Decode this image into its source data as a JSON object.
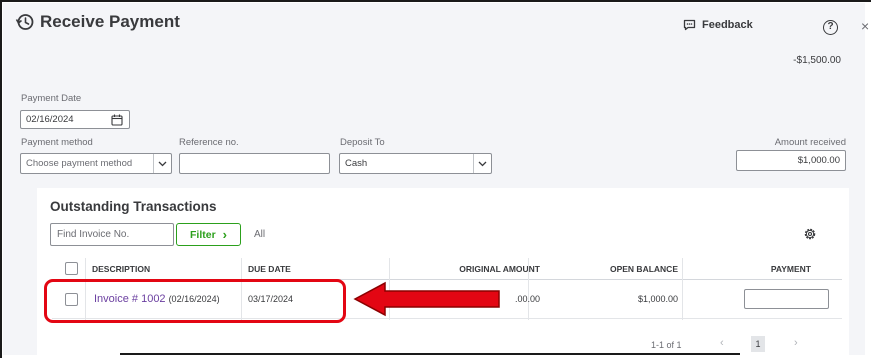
{
  "header": {
    "title": "Receive Payment",
    "feedback_label": "Feedback",
    "help_glyph": "?",
    "close_glyph": "×",
    "balance": "-$1,500.00"
  },
  "form": {
    "payment_date_label": "Payment Date",
    "payment_date_value": "02/16/2024",
    "payment_method_label": "Payment method",
    "payment_method_placeholder": "Choose payment method",
    "reference_label": "Reference no.",
    "reference_value": "",
    "deposit_to_label": "Deposit To",
    "deposit_to_value": "Cash",
    "amount_received_label": "Amount received",
    "amount_received_value": "$1,000.00"
  },
  "outstanding": {
    "title": "Outstanding Transactions",
    "find_placeholder": "Find Invoice No.",
    "filter_label": "Filter",
    "filter_glyph": "›",
    "all_label": "All",
    "columns": {
      "description": "DESCRIPTION",
      "due_date": "DUE DATE",
      "original_amount": "ORIGINAL AMOUNT",
      "open_balance": "OPEN BALANCE",
      "payment": "PAYMENT"
    },
    "rows": [
      {
        "invoice": "Invoice # 1002",
        "invoice_date": "(02/16/2024)",
        "due_date": "03/17/2024",
        "original_amount": ".00.00",
        "open_balance": "$1,000.00",
        "payment": ""
      }
    ],
    "pagination": {
      "range": "1-1 of 1",
      "prev": "‹",
      "current": "1",
      "next": "›"
    }
  },
  "icons": {
    "history": "history-icon",
    "feedback": "feedback-icon",
    "help": "help-icon",
    "close": "close-icon",
    "calendar": "calendar-icon",
    "chevron": "chevron-down-icon",
    "gear": "gear-icon",
    "annotation_arrow": "left-arrow-annotation"
  },
  "colors": {
    "accent_green": "#2ca01c",
    "link_purple": "#6b3fa0",
    "annotation_red": "#e30613"
  }
}
